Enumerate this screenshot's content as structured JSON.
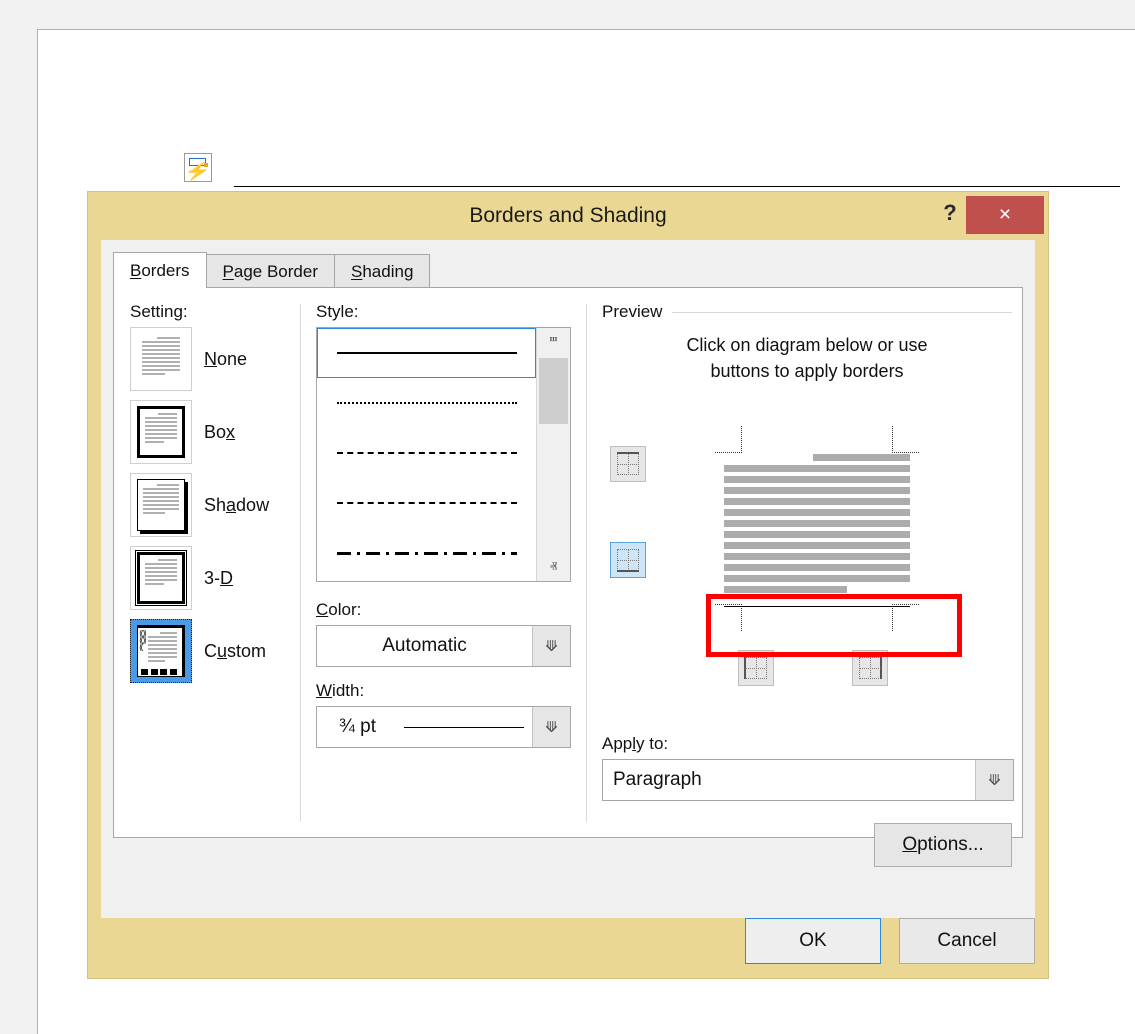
{
  "document": {
    "autocorrect_icon": "autocorrect-lightning-icon"
  },
  "dialog": {
    "title": "Borders and Shading",
    "help_label": "?",
    "close_label": "×",
    "tabs": [
      {
        "label": "Borders",
        "accel": "B",
        "rest": "orders",
        "active": true
      },
      {
        "label": "Page Border",
        "accel": "P",
        "rest": "age Border",
        "active": false
      },
      {
        "label": "Shading",
        "accel": "S",
        "rest": "hading",
        "active": false
      }
    ],
    "setting": {
      "label": "Setting:",
      "options": [
        {
          "label": "None",
          "accel": "N",
          "pre": "",
          "rest": "one",
          "selected": false
        },
        {
          "label": "Box",
          "accel": "x",
          "pre": "Bo",
          "rest": "",
          "selected": false
        },
        {
          "label": "Shadow",
          "accel": "a",
          "pre": "Sh",
          "rest": "dow",
          "selected": false
        },
        {
          "label": "3-D",
          "accel": "D",
          "pre": "3-",
          "rest": "",
          "selected": false
        },
        {
          "label": "Custom",
          "accel": "u",
          "pre": "C",
          "rest": "stom",
          "selected": true
        }
      ]
    },
    "style": {
      "label": "Style:",
      "options": [
        {
          "name": "solid",
          "selected": true
        },
        {
          "name": "dotted",
          "selected": false
        },
        {
          "name": "fine-dashed",
          "selected": false
        },
        {
          "name": "dashed",
          "selected": false
        },
        {
          "name": "dash-dot",
          "selected": false
        }
      ],
      "scroll_up_glyph": "ⱎ",
      "scroll_down_glyph": "ⱏ"
    },
    "color": {
      "label": "Color:",
      "accel": "C",
      "rest": "olor:",
      "value": "Automatic"
    },
    "width": {
      "label": "Width:",
      "accel": "W",
      "rest": "idth:",
      "value": "¾ pt"
    },
    "preview": {
      "label": "Preview",
      "hint_line1": "Click on diagram below or use",
      "hint_line2": "buttons to apply borders",
      "buttons": [
        {
          "name": "top-border-toggle",
          "edge": "top",
          "active": false
        },
        {
          "name": "bottom-border-toggle",
          "edge": "bottom",
          "active": true
        },
        {
          "name": "left-border-toggle",
          "edge": "left",
          "active": false
        },
        {
          "name": "right-border-toggle",
          "edge": "right",
          "active": false
        }
      ],
      "applied_borders": [
        "bottom"
      ],
      "annotation_color": "#ff0000"
    },
    "apply_to": {
      "label": "Apply to:",
      "pre": "App",
      "accel": "l",
      "rest": "y to:",
      "value": "Paragraph"
    },
    "options_button": {
      "label": "Options...",
      "accel": "O",
      "rest": "ptions..."
    },
    "footer_buttons": [
      {
        "label": "OK",
        "default": true
      },
      {
        "label": "Cancel",
        "default": false
      }
    ],
    "colors": {
      "chrome": "#ead793",
      "close_button": "#c0504d",
      "accent_blue": "#2a8ae0",
      "annotation_red": "#ff0000"
    }
  }
}
